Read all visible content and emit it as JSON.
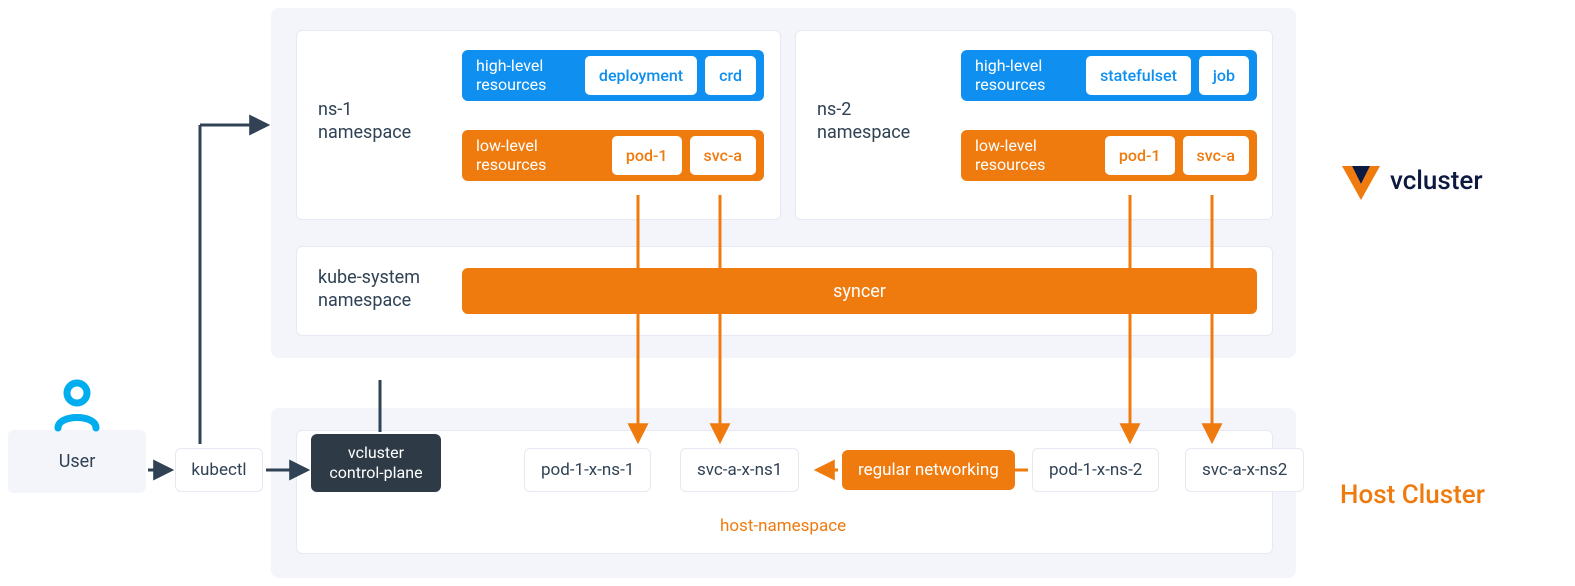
{
  "logo_text": "vcluster",
  "host_cluster_label": "Host Cluster",
  "user_label": "User",
  "kubectl_label": "kubectl",
  "ctrlplane_label": "vcluster\ncontrol-plane",
  "vcluster_panel": {
    "ns1": {
      "label": "ns-1\nnamespace",
      "high": {
        "title": "high-level\nresources",
        "items": [
          "deployment",
          "crd"
        ]
      },
      "low": {
        "title": "low-level\nresources",
        "items": [
          "pod-1",
          "svc-a"
        ]
      }
    },
    "ns2": {
      "label": "ns-2\nnamespace",
      "high": {
        "title": "high-level\nresources",
        "items": [
          "statefulset",
          "job"
        ]
      },
      "low": {
        "title": "low-level\nresources",
        "items": [
          "pod-1",
          "svc-a"
        ]
      }
    },
    "kube_system_label": "kube-system\nnamespace",
    "syncer_label": "syncer"
  },
  "host_panel": {
    "items": [
      "pod-1-x-ns-1",
      "svc-a-x-ns1",
      "pod-1-x-ns-2",
      "svc-a-x-ns2"
    ],
    "regular_networking": "regular networking",
    "host_namespace_label": "host-namespace"
  }
}
